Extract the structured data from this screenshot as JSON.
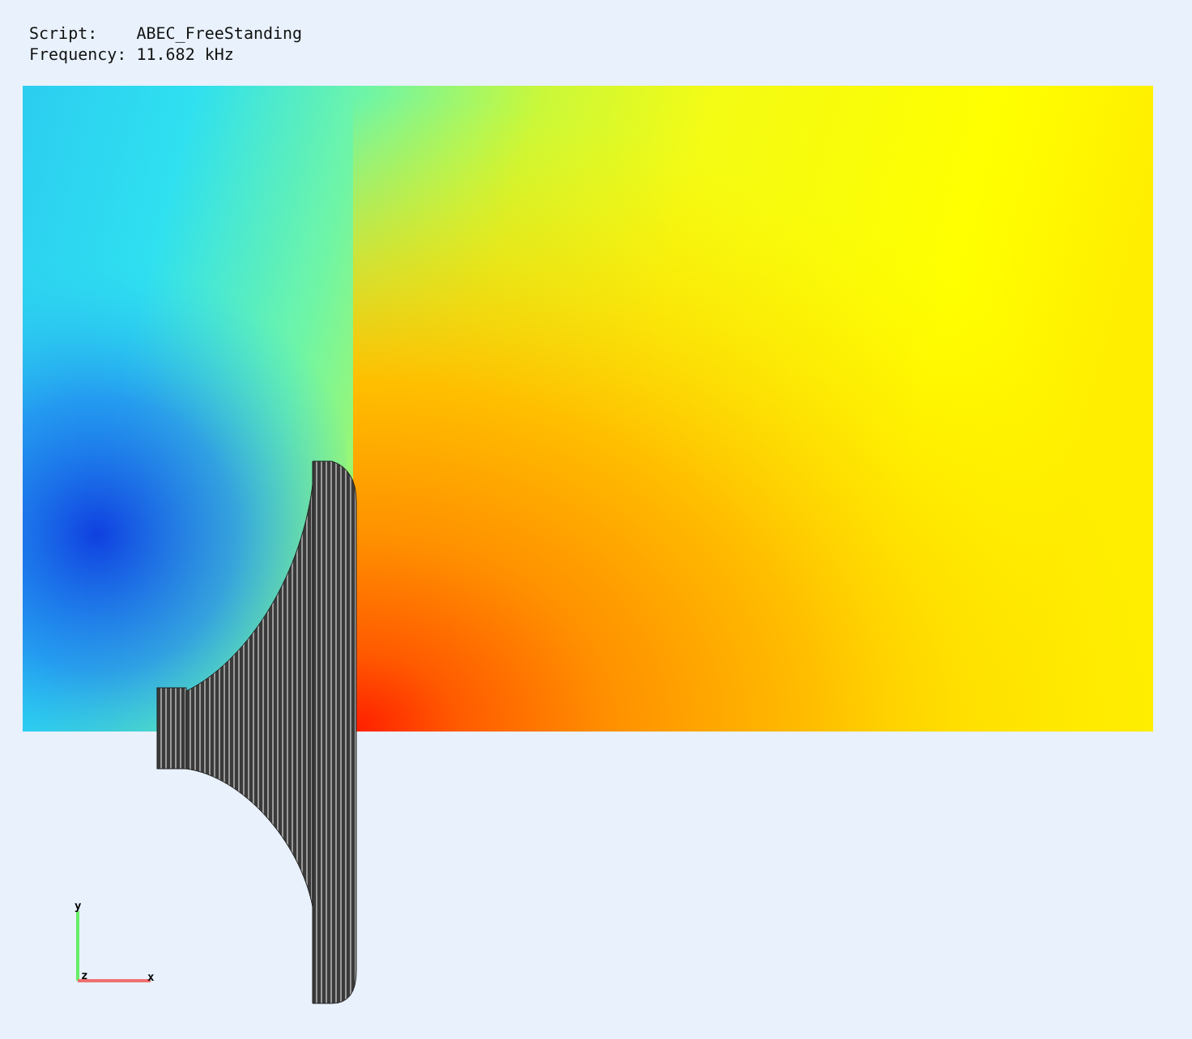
{
  "info": [
    {
      "label": "Script:",
      "value": "ABEC_FreeStanding"
    },
    {
      "label": "Frequency:",
      "value": "11.682 kHz"
    }
  ],
  "axes": [
    {
      "label": "y",
      "color": "#66ee66"
    },
    {
      "label": "z",
      "color": "#000000"
    },
    {
      "label": "x",
      "color": "#f07070"
    }
  ]
}
